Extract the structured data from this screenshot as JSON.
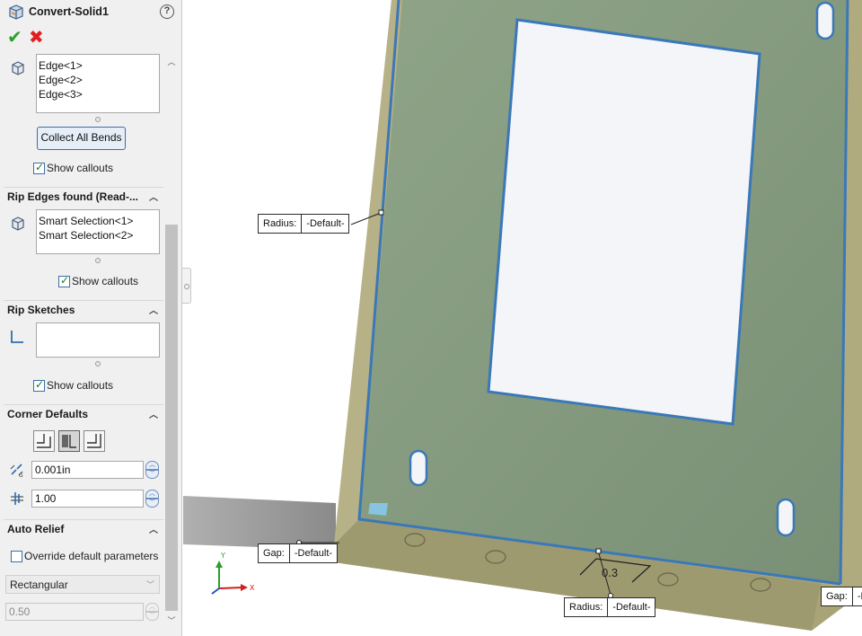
{
  "property_manager": {
    "title": "Convert-Solid1",
    "help_label": "?",
    "ok_label": "✔",
    "cancel_label": "✖",
    "bend_edges": {
      "items": [
        "Edge<1>",
        "Edge<2>",
        "Edge<3>"
      ],
      "collect_button": "Collect All Bends",
      "show_callouts": "Show callouts",
      "show_callouts_checked": true
    },
    "rip_edges": {
      "header": "Rip Edges found (Read-...",
      "items": [
        "Smart Selection<1>",
        "Smart Selection<2>"
      ],
      "show_callouts": "Show callouts",
      "show_callouts_checked": true
    },
    "rip_sketches": {
      "header": "Rip Sketches",
      "items": [],
      "show_callouts": "Show callouts",
      "show_callouts_checked": true
    },
    "corner_defaults": {
      "header": "Corner Defaults",
      "gap_value": "0.001in",
      "ratio_value": "1.00"
    },
    "auto_relief": {
      "header": "Auto Relief",
      "override_label": "Override default parameters",
      "override_checked": false,
      "type_value": "Rectangular",
      "ratio_value": "0.50"
    }
  },
  "viewport": {
    "callouts": [
      {
        "key": "Radius:",
        "value": "-Default-"
      },
      {
        "key": "Gap:",
        "value": "-Default-"
      },
      {
        "key": "Radius:",
        "value": "-Default-"
      },
      {
        "key": "Gap:",
        "value": "-D"
      }
    ],
    "dimension_text": "0.3",
    "triad": {
      "y": "Y",
      "x": "X"
    },
    "colors": {
      "part_face": "#7e9479",
      "part_face_light": "#8fa487",
      "part_edge": "#b4ae80",
      "selected_edge": "#3a78b8",
      "window": "#f4f5f8",
      "floor_shadow": "#9a9a9a"
    }
  }
}
